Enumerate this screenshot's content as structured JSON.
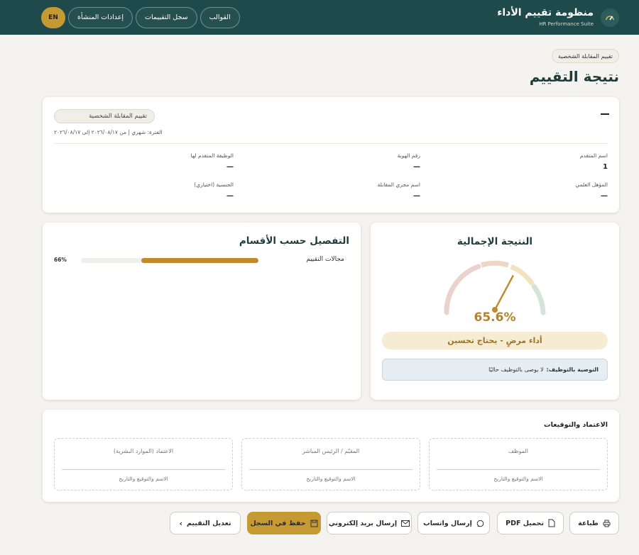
{
  "app": {
    "title": "منظومة تقييم الأداء",
    "subtitle": "HR Performance Suite"
  },
  "nav": {
    "templates": "القوالب",
    "records": "سجل التقييمات",
    "settings": "إعدادات المنشأة",
    "lang": "EN"
  },
  "breadcrumb": "تقييم المقابلة الشخصية",
  "page_title": "نتيجة التقييم",
  "info": {
    "form_name": "تقييم المقابلة الشخصية",
    "period": "الفترة: شهري | من ٢٠٢٦/٠٨/١٧ إلى ٢٠٢٦/٠٨/١٧",
    "fields": [
      {
        "label": "اسم المتقدم",
        "value": "1"
      },
      {
        "label": "رقم الهوية",
        "value": "—"
      },
      {
        "label": "الوظيفة المتقدم لها",
        "value": "—"
      },
      {
        "label": "المؤهل العلمي",
        "value": "—"
      },
      {
        "label": "اسم مجري المقابلة",
        "value": "—"
      },
      {
        "label": "الجنسية (اختياري)",
        "value": "—"
      }
    ]
  },
  "result": {
    "title": "النتيجة الإجمالية",
    "score": "65.6%",
    "score_value": 65.6,
    "status": "أداء مرضٍ - يحتاج تحسين",
    "reco_label": "التوصية بالتوظيف:",
    "reco_value": "لا يوصى بالتوظيف حاليًا"
  },
  "breakdown": {
    "title": "التفصيل حسب الأقسام",
    "items": [
      {
        "label": "مجالات التقييم",
        "pct_text": "66%",
        "pct": 66
      }
    ]
  },
  "signatures": {
    "title": "الاعتماد والتوقيعات",
    "hint": "الاسم والتوقيع والتاريخ",
    "roles": [
      "الموظف",
      "المقيّم / الرئيس المباشر",
      "الاعتماد (الموارد البشرية)"
    ]
  },
  "actions": {
    "print": "طباعة",
    "pdf": "تحميل PDF",
    "whatsapp": "إرسال واتساب",
    "email": "إرسال بريد إلكتروني",
    "save": "حفظ في السجل",
    "edit": "تعديل التقييم"
  },
  "colors": {
    "header": "#1f4a4c",
    "accent": "#c59a33",
    "score": "#b5822a"
  }
}
